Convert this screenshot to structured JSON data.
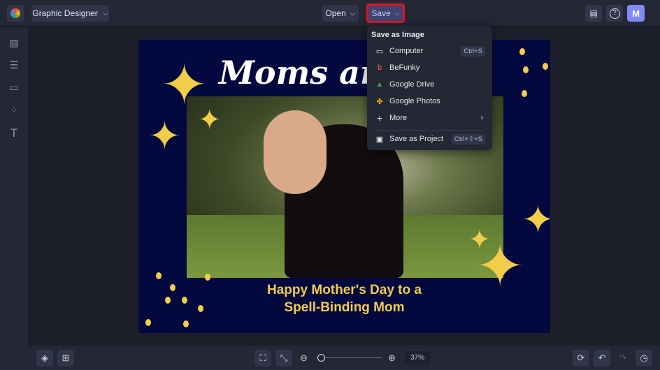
{
  "header": {
    "app_title": "Graphic Designer",
    "open_label": "Open",
    "save_label": "Save",
    "avatar_initial": "M"
  },
  "save_menu": {
    "heading": "Save as Image",
    "items": [
      {
        "label": "Computer",
        "shortcut": "Ctrl+S",
        "icon": "monitor-icon"
      },
      {
        "label": "BeFunky",
        "icon": "befunky-icon"
      },
      {
        "label": "Google Drive",
        "icon": "google-drive-icon"
      },
      {
        "label": "Google Photos",
        "icon": "google-photos-icon"
      },
      {
        "label": "More",
        "icon": "plus-icon"
      },
      {
        "label": "Save as Project",
        "shortcut": "Ctrl+⇧+S",
        "icon": "briefcase-icon"
      }
    ]
  },
  "design": {
    "title": "Moms are",
    "subtitle_line1": "Happy Mother's Day to a",
    "subtitle_line2": "Spell-Binding Mom"
  },
  "bottom": {
    "zoom_percent": "37%",
    "zoom_value": 0.05
  },
  "colors": {
    "accent_yellow": "#f1cd4a",
    "navy": "#03093f",
    "highlight": "#e0141e"
  }
}
